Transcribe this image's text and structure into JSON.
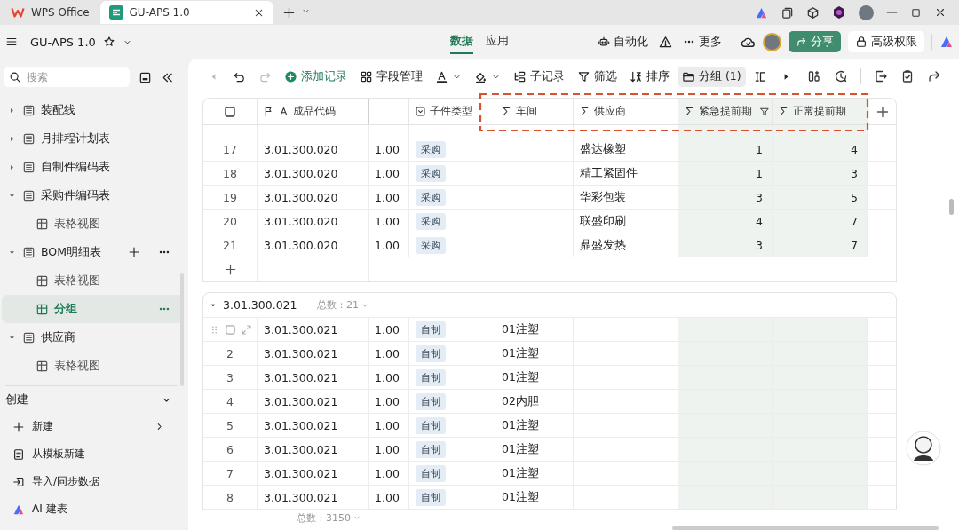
{
  "window": {
    "tabs": [
      {
        "label": "WPS Office",
        "selected": false
      },
      {
        "label": "GU-APS 1.0",
        "selected": true
      }
    ]
  },
  "topbar": {
    "title": "GU-APS 1.0",
    "nav": [
      {
        "label": "数据",
        "selected": true
      },
      {
        "label": "应用",
        "selected": false
      }
    ],
    "automation": "自动化",
    "more": "更多",
    "share": "分享",
    "permissions": "高级权限"
  },
  "sidebar": {
    "search": {
      "placeholder": "搜索"
    },
    "tables": [
      {
        "label": "装配线",
        "expanded": false,
        "hovered": false
      },
      {
        "label": "月排程计划表",
        "expanded": false,
        "hovered": false
      },
      {
        "label": "自制件编码表",
        "expanded": false,
        "hovered": false
      },
      {
        "label": "采购件编码表",
        "expanded": true,
        "hovered": false,
        "children": [
          {
            "label": "表格视图",
            "selected": false
          }
        ]
      },
      {
        "label": "BOM明细表",
        "expanded": true,
        "hovered": true,
        "children": [
          {
            "label": "表格视图",
            "selected": false
          },
          {
            "label": "分组",
            "selected": true
          }
        ]
      },
      {
        "label": "供应商",
        "expanded": true,
        "hovered": false,
        "children": [
          {
            "label": "表格视图",
            "selected": false
          }
        ]
      }
    ],
    "create": {
      "title": "创建",
      "items": [
        {
          "label": "新建",
          "kind": "new"
        },
        {
          "label": "从模板新建",
          "kind": "template"
        },
        {
          "label": "导入/同步数据",
          "kind": "import"
        },
        {
          "label": "AI 建表",
          "kind": "ai"
        }
      ]
    }
  },
  "toolbar": [
    {
      "kind": "back",
      "disabled": true,
      "active": false
    },
    {
      "kind": "undo",
      "disabled": false,
      "active": false
    },
    {
      "kind": "redo",
      "disabled": true,
      "active": false
    },
    {
      "kind": "add",
      "label": "添加记录",
      "disabled": false,
      "active": false
    },
    {
      "kind": "fields",
      "label": "字段管理",
      "disabled": false,
      "active": false
    },
    {
      "kind": "text-color",
      "disabled": false,
      "active": false
    },
    {
      "kind": "fill-color",
      "disabled": false,
      "active": false
    },
    {
      "kind": "subrecord",
      "label": "子记录",
      "disabled": false,
      "active": false
    },
    {
      "kind": "filter",
      "label": "筛选",
      "disabled": false,
      "active": false
    },
    {
      "kind": "sort",
      "label": "排序",
      "disabled": false,
      "active": false
    },
    {
      "kind": "group",
      "label": "分组 (1)",
      "disabled": false,
      "active": true
    },
    {
      "kind": "row-height",
      "disabled": false,
      "active": false
    }
  ],
  "table": {
    "columns": [
      {
        "label": "成品代码",
        "kind": "primary",
        "highlighted": false,
        "filtered": false
      },
      {
        "kind": "number",
        "highlighted": false,
        "filtered": false
      },
      {
        "label": "子件类型",
        "kind": "select",
        "highlighted": false,
        "filtered": false
      },
      {
        "label": "车间",
        "kind": "formula",
        "highlighted": false,
        "filtered": false
      },
      {
        "label": "供应商",
        "kind": "formula",
        "highlighted": false,
        "filtered": false
      },
      {
        "label": "紧急提前期",
        "kind": "formula",
        "highlighted": true,
        "filtered": true
      },
      {
        "label": "正常提前期",
        "kind": "formula",
        "highlighted": true,
        "filtered": false
      }
    ],
    "groups": [
      {
        "rows": [
          {
            "num": "17",
            "hovered": false,
            "code": "3.01.300.020",
            "qty": "1.00",
            "type": "采购",
            "supplier": "盛达橡塑",
            "urgent": "1",
            "normal": "4"
          },
          {
            "num": "18",
            "hovered": false,
            "code": "3.01.300.020",
            "qty": "1.00",
            "type": "采购",
            "supplier": "精工紧固件",
            "urgent": "1",
            "normal": "3"
          },
          {
            "num": "19",
            "hovered": false,
            "code": "3.01.300.020",
            "qty": "1.00",
            "type": "采购",
            "supplier": "华彩包装",
            "urgent": "3",
            "normal": "5"
          },
          {
            "num": "20",
            "hovered": false,
            "code": "3.01.300.020",
            "qty": "1.00",
            "type": "采购",
            "supplier": "联盛印刷",
            "urgent": "4",
            "normal": "7"
          },
          {
            "num": "21",
            "hovered": false,
            "code": "3.01.300.020",
            "qty": "1.00",
            "type": "采购",
            "supplier": "鼎盛发热",
            "urgent": "3",
            "normal": "7"
          }
        ]
      },
      {
        "title": "3.01.300.021",
        "count": "总数：21",
        "expanded": true,
        "rows": [
          {
            "hovered": true,
            "code": "3.01.300.021",
            "qty": "1.00",
            "type": "自制",
            "workshop": "01注塑"
          },
          {
            "num": "2",
            "hovered": false,
            "code": "3.01.300.021",
            "qty": "1.00",
            "type": "自制",
            "workshop": "01注塑"
          },
          {
            "num": "3",
            "hovered": false,
            "code": "3.01.300.021",
            "qty": "1.00",
            "type": "自制",
            "workshop": "01注塑"
          },
          {
            "num": "4",
            "hovered": false,
            "code": "3.01.300.021",
            "qty": "1.00",
            "type": "自制",
            "workshop": "02内胆"
          },
          {
            "num": "5",
            "hovered": false,
            "code": "3.01.300.021",
            "qty": "1.00",
            "type": "自制",
            "workshop": "01注塑"
          },
          {
            "num": "6",
            "hovered": false,
            "code": "3.01.300.021",
            "qty": "1.00",
            "type": "自制",
            "workshop": "01注塑"
          },
          {
            "num": "7",
            "hovered": false,
            "code": "3.01.300.021",
            "qty": "1.00",
            "type": "自制",
            "workshop": "01注塑"
          },
          {
            "num": "8",
            "hovered": false,
            "code": "3.01.300.021",
            "qty": "1.00",
            "type": "自制",
            "workshop": "01注塑"
          }
        ]
      }
    ],
    "total": "总数：3150"
  }
}
